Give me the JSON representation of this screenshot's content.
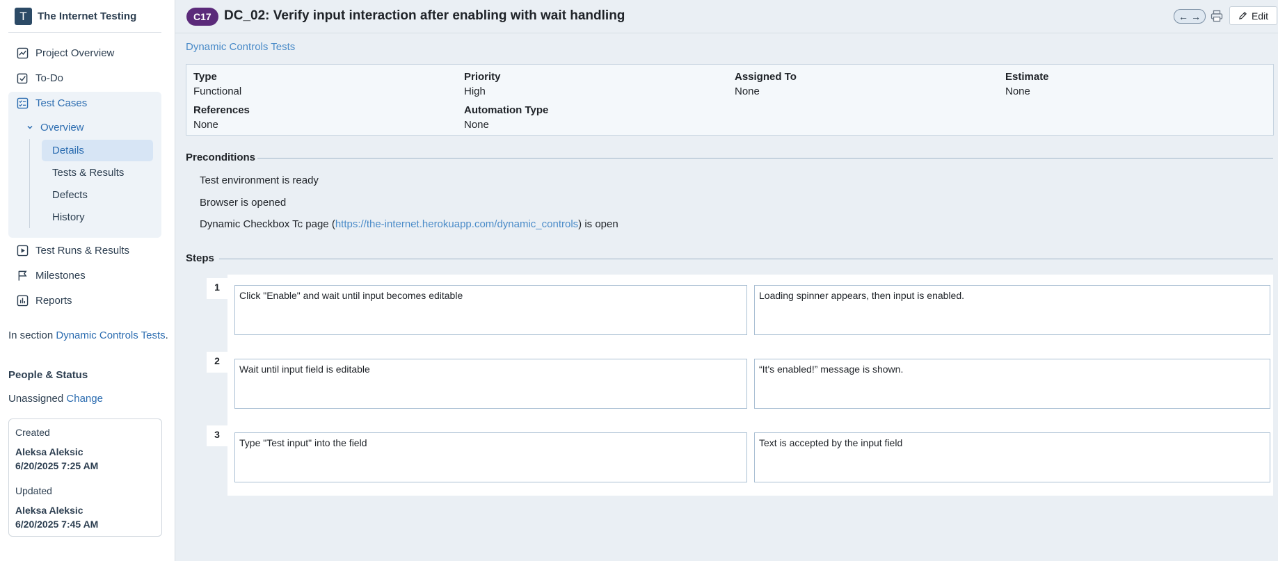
{
  "sidebar": {
    "project_initial": "T",
    "project_name": "The Internet Testing",
    "nav": [
      {
        "label": "Project Overview",
        "icon": "chart-line-icon"
      },
      {
        "label": "To-Do",
        "icon": "checkbox-icon"
      },
      {
        "label": "Test Cases",
        "icon": "checklist-icon"
      },
      {
        "label": "Test Runs & Results",
        "icon": "play-box-icon"
      },
      {
        "label": "Milestones",
        "icon": "flag-icon"
      },
      {
        "label": "Reports",
        "icon": "bar-chart-icon"
      }
    ],
    "overview_label": "Overview",
    "sub_items": [
      "Details",
      "Tests & Results",
      "Defects",
      "History"
    ],
    "in_section_prefix": "In section ",
    "in_section_link": "Dynamic Controls Tests",
    "in_section_suffix": ".",
    "people_title": "People & Status",
    "assignment_status": "Unassigned",
    "change_label": "Change",
    "created_label": "Created",
    "created_by": "Aleksa Aleksic",
    "created_at": "6/20/2025 7:25 AM",
    "updated_label": "Updated",
    "updated_by": "Aleksa Aleksic",
    "updated_at": "6/20/2025 7:45 AM"
  },
  "header": {
    "case_id": "C17",
    "title": "DC_02: Verify input interaction after enabling with wait handling",
    "edit_label": "Edit"
  },
  "main": {
    "section_link": "Dynamic Controls Tests",
    "fields": {
      "type_label": "Type",
      "type_value": "Functional",
      "priority_label": "Priority",
      "priority_value": "High",
      "assigned_label": "Assigned To",
      "assigned_value": "None",
      "estimate_label": "Estimate",
      "estimate_value": "None",
      "references_label": "References",
      "references_value": "None",
      "automation_label": "Automation Type",
      "automation_value": "None"
    },
    "preconditions_title": "Preconditions",
    "preconditions": {
      "line1": "Test environment is ready",
      "line2": "Browser is opened",
      "line3_prefix": "Dynamic Checkbox Tc page (",
      "line3_link": "https://the-internet.herokuapp.com/dynamic_controls",
      "line3_suffix": ") is open"
    },
    "steps_title": "Steps",
    "steps": [
      {
        "num": "1",
        "action": "Click \"Enable\" and wait until input becomes editable",
        "expected": "Loading spinner appears, then input is enabled."
      },
      {
        "num": "2",
        "action": "Wait until input field is editable",
        "expected": "“It's enabled!” message is shown."
      },
      {
        "num": "3",
        "action": "Type \"Test input\" into the field",
        "expected": "Text is accepted by the input field"
      }
    ]
  },
  "colors": {
    "accent": "#2b6cb0",
    "badge": "#5b2a7a",
    "page_bg": "#eaeff4"
  }
}
